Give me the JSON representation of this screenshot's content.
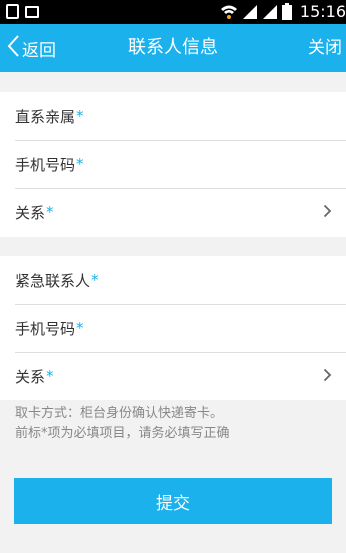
{
  "status_bar": {
    "time": "15:16",
    "icons": [
      "sim-icon",
      "image-icon",
      "wifi-icon",
      "signal-icon",
      "signal-icon",
      "battery-icon"
    ]
  },
  "nav": {
    "back_label": "返回",
    "title": "联系人信息",
    "close_label": "关闭"
  },
  "group1": {
    "rows": [
      {
        "label": "直系亲属",
        "required": "*"
      },
      {
        "label": "手机号码",
        "required": "*"
      },
      {
        "label": "关系",
        "required": "*"
      }
    ]
  },
  "group2": {
    "rows": [
      {
        "label": "紧急联系人",
        "required": "*"
      },
      {
        "label": "手机号码",
        "required": "*"
      },
      {
        "label": "关系",
        "required": "*"
      }
    ]
  },
  "note": {
    "line1": "取卡方式：柜台身份确认快递寄卡。",
    "line2": "前标*项为必填项目，请务必填写正确"
  },
  "submit_label": "提交",
  "colors": {
    "accent": "#1bb1ec",
    "background": "#f2f2f2",
    "status_bar": "#000000"
  }
}
